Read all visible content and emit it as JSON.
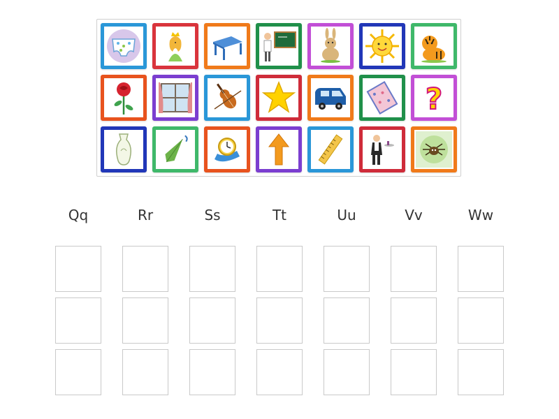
{
  "headings": [
    "Qq",
    "Rr",
    "Ss",
    "Tt",
    "Uu",
    "Vv",
    "Ww"
  ],
  "cards": [
    {
      "name": "underpants",
      "icon": "underpants-icon",
      "frame": "#2a97d8"
    },
    {
      "name": "queen",
      "icon": "queen-icon",
      "frame": "#d9343c"
    },
    {
      "name": "table",
      "icon": "table-icon",
      "frame": "#f07a1a"
    },
    {
      "name": "teacher",
      "icon": "teacher-icon",
      "frame": "#20904a"
    },
    {
      "name": "rabbit",
      "icon": "rabbit-icon",
      "frame": "#c24fd6"
    },
    {
      "name": "sun",
      "icon": "sun-icon",
      "frame": "#2137b8"
    },
    {
      "name": "tiger",
      "icon": "tiger-icon",
      "frame": "#3fb86a"
    },
    {
      "name": "rose",
      "icon": "rose-icon",
      "frame": "#e8531e"
    },
    {
      "name": "window",
      "icon": "window-icon",
      "frame": "#7b3ed0"
    },
    {
      "name": "violin",
      "icon": "violin-icon",
      "frame": "#2a97d8"
    },
    {
      "name": "star",
      "icon": "star-icon",
      "frame": "#cf2c3a"
    },
    {
      "name": "van",
      "icon": "van-icon",
      "frame": "#f07a1a"
    },
    {
      "name": "quilt",
      "icon": "quilt-icon",
      "frame": "#20904a"
    },
    {
      "name": "question-mark",
      "icon": "question-mark-icon",
      "frame": "#c24fd6"
    },
    {
      "name": "vase",
      "icon": "vase-icon",
      "frame": "#2137b8"
    },
    {
      "name": "umbrella",
      "icon": "umbrella-icon",
      "frame": "#3fb86a"
    },
    {
      "name": "watch",
      "icon": "watch-icon",
      "frame": "#e8531e"
    },
    {
      "name": "up-arrow",
      "icon": "up-arrow-icon",
      "frame": "#7b3ed0"
    },
    {
      "name": "ruler",
      "icon": "ruler-icon",
      "frame": "#2a97d8"
    },
    {
      "name": "waiter",
      "icon": "waiter-icon",
      "frame": "#cf2c3a"
    },
    {
      "name": "web-spider",
      "icon": "web-spider-icon",
      "frame": "#f07a1a"
    }
  ]
}
